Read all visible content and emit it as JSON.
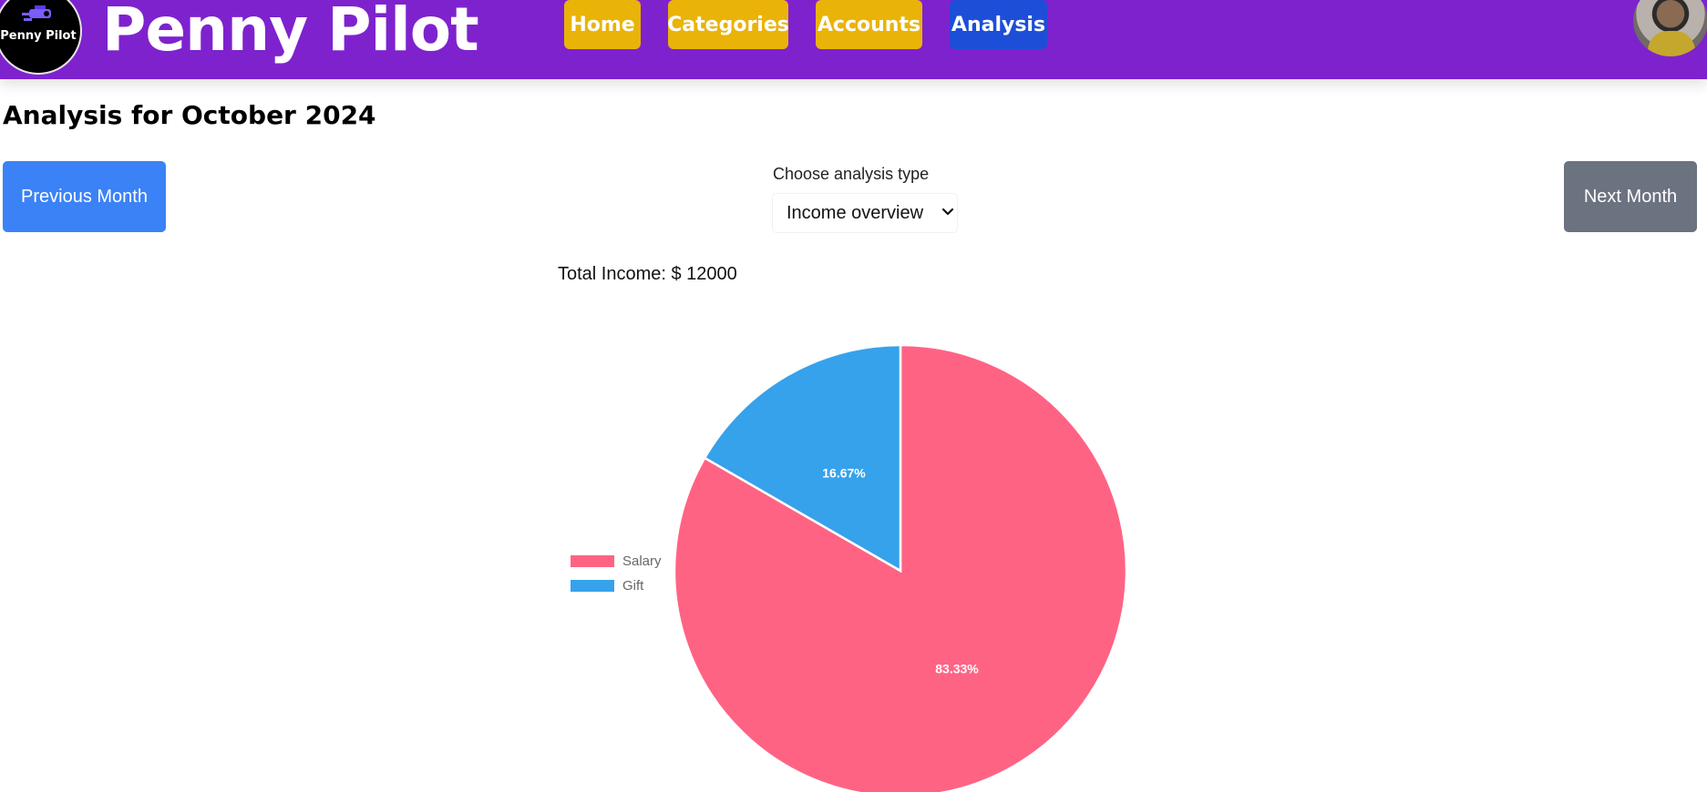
{
  "brand": {
    "logo_text": "Penny Pilot",
    "title": "Penny Pilot"
  },
  "nav": {
    "items": [
      {
        "label": "Home"
      },
      {
        "label": "Categories"
      },
      {
        "label": "Accounts"
      },
      {
        "label": "Analysis",
        "active": true
      }
    ]
  },
  "page": {
    "title": "Analysis for October 2024",
    "prev_label": "Previous Month",
    "next_label": "Next Month",
    "select_label": "Choose analysis type",
    "select_value": "Income overview",
    "total_income": "Total Income: $ 12000"
  },
  "colors": {
    "navbar": "#7e22ce",
    "nav_button": "#eab308",
    "nav_active": "#1d4ed8",
    "prev_button": "#3b82f6",
    "next_button": "#6b7280"
  },
  "icons": {
    "logo": "penny-pilot-logo-icon",
    "select": "chevron-down-icon",
    "avatar": "user-avatar"
  },
  "chart_data": {
    "type": "pie",
    "legend_position": "left",
    "slices": [
      {
        "label": "Salary",
        "value": 10000,
        "percent_label": "83.33%",
        "color": "#ff6384"
      },
      {
        "label": "Gift",
        "value": 2000,
        "percent_label": "16.67%",
        "color": "#36a2eb"
      }
    ]
  }
}
